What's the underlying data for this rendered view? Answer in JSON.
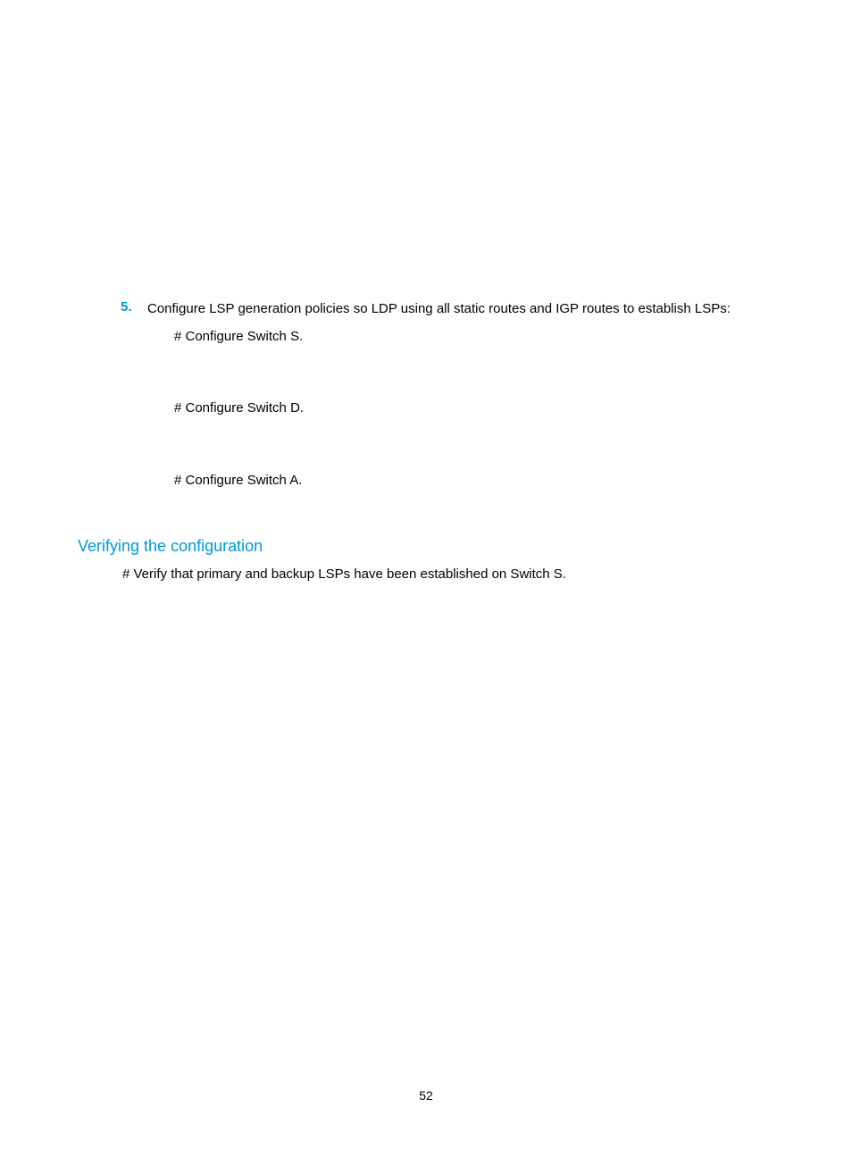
{
  "step": {
    "number": "5.",
    "text": "Configure LSP generation policies so LDP using all static routes and IGP routes to establish LSPs:"
  },
  "configS": "# Configure Switch S.",
  "configD": "# Configure Switch D.",
  "configA": "# Configure Switch A.",
  "heading": "Verifying the configuration",
  "verifyText": "# Verify that primary and backup LSPs have been established on Switch S.",
  "pageNumber": "52"
}
